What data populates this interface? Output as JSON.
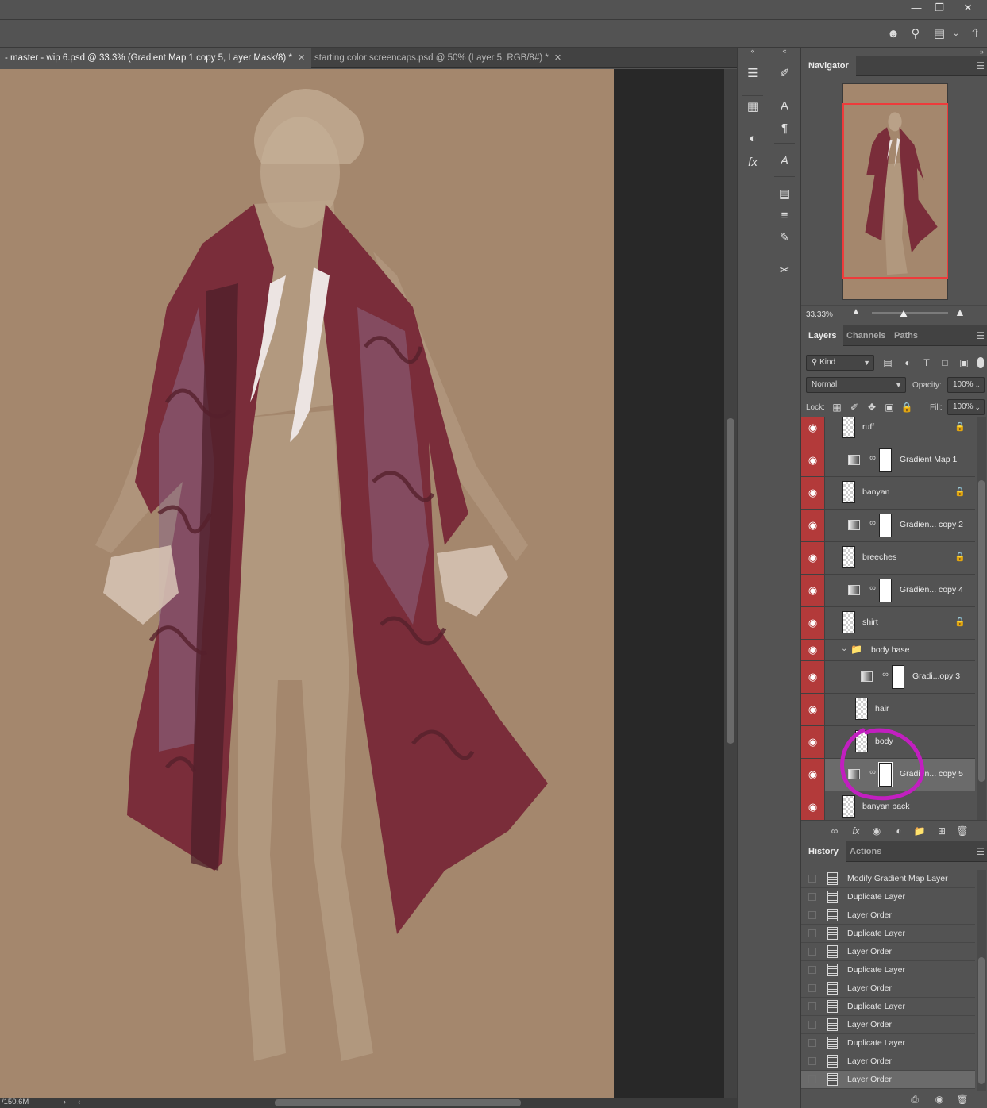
{
  "window": {
    "minimize_icon": "minimize-icon",
    "restore_icon": "restore-icon",
    "close_icon": "close-icon"
  },
  "optbar": {
    "icons": [
      "user-add-icon",
      "search-icon",
      "workspace-icon",
      "share-icon"
    ]
  },
  "tabs": [
    {
      "label": "- master - wip 6.psd @ 33.3% (Gradient Map 1 copy 5, Layer Mask/8) *",
      "active": true
    },
    {
      "label": "starting color screencaps.psd @ 50% (Layer 5, RGB/8#) *",
      "active": false
    }
  ],
  "status": {
    "doc_size": "/150.6M"
  },
  "navigator": {
    "tab_label": "Navigator",
    "zoom": "33.33%"
  },
  "layers_panel": {
    "tabs": [
      "Layers",
      "Channels",
      "Paths"
    ],
    "filter_kind": "Kind",
    "blend_mode": "Normal",
    "opacity_label": "Opacity:",
    "opacity_value": "100%",
    "lock_label": "Lock:",
    "fill_label": "Fill:",
    "fill_value": "100%",
    "layers": [
      {
        "name": "ruff",
        "type": "pixel",
        "locked": true
      },
      {
        "name": "Gradient Map 1",
        "type": "adjustment"
      },
      {
        "name": "banyan",
        "type": "pixel",
        "locked": true
      },
      {
        "name": "Gradien... copy 2",
        "type": "adjustment"
      },
      {
        "name": "breeches",
        "type": "pixel",
        "locked": true
      },
      {
        "name": "Gradien... copy 4",
        "type": "adjustment"
      },
      {
        "name": "shirt",
        "type": "pixel",
        "locked": true
      },
      {
        "name": "body base",
        "type": "group"
      },
      {
        "name": "Gradi...opy 3",
        "type": "adjustment",
        "indent": true
      },
      {
        "name": "hair",
        "type": "pixel",
        "indent": true
      },
      {
        "name": "body",
        "type": "pixel",
        "indent": true
      },
      {
        "name": "Gradien... copy 5",
        "type": "adjustment",
        "selected": true
      },
      {
        "name": "banyan back",
        "type": "pixel"
      }
    ]
  },
  "history_panel": {
    "tabs": [
      "History",
      "Actions"
    ],
    "items": [
      "Modify Gradient Map Layer",
      "Duplicate Layer",
      "Layer Order",
      "Duplicate Layer",
      "Layer Order",
      "Duplicate Layer",
      "Layer Order",
      "Duplicate Layer",
      "Layer Order",
      "Duplicate Layer",
      "Layer Order",
      "Layer Order"
    ]
  },
  "colors": {
    "canvas_bg": "#a4876d",
    "coat": "#7a2d3a",
    "eye_column": "#b33a3a",
    "annotation": "#c21fc0",
    "nav_frame": "#ee3b3b"
  }
}
